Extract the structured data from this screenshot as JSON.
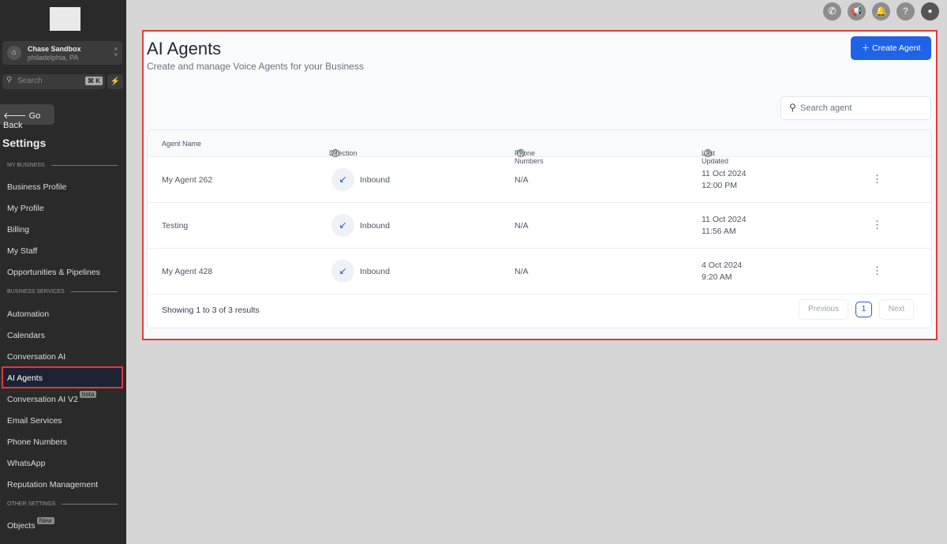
{
  "account": {
    "name": "Chase Sandbox",
    "location": "philadelphia, PA"
  },
  "search": {
    "placeholder": "Search",
    "shortcut": "⌘ K"
  },
  "go_back": "Go Back",
  "settings_title": "Settings",
  "sections": {
    "my_business": "MY BUSINESS",
    "business_services": "BUSINESS SERVICES",
    "other_settings": "OTHER SETTINGS"
  },
  "nav": [
    "Business Profile",
    "My Profile",
    "Billing",
    "My Staff",
    "Opportunities & Pipelines",
    "Automation",
    "Calendars",
    "Conversation AI",
    "AI Agents",
    "Conversation AI V2",
    "Email Services",
    "Phone Numbers",
    "WhatsApp",
    "Reputation Management",
    "Objects"
  ],
  "badges": {
    "beta": "beta",
    "new": "New"
  },
  "page": {
    "title": "AI Agents",
    "subtitle": "Create and manage Voice Agents for your Business",
    "create_label": "Create Agent",
    "search_placeholder": "Search agent"
  },
  "table": {
    "headers": [
      "Agent Name",
      "Direction",
      "Phone Numbers",
      "Last Updated"
    ],
    "rows": [
      {
        "name": "My Agent 262",
        "direction": "Inbound",
        "phone": "N/A",
        "date": "11 Oct 2024",
        "time": "12:00 PM"
      },
      {
        "name": "Testing",
        "direction": "Inbound",
        "phone": "N/A",
        "date": "11 Oct 2024",
        "time": "11:56 AM"
      },
      {
        "name": "My Agent 428",
        "direction": "Inbound",
        "phone": "N/A",
        "date": "4 Oct 2024",
        "time": "9:20 AM"
      }
    ]
  },
  "pagination": {
    "summary": "Showing 1 to 3 of 3 results",
    "previous": "Previous",
    "current": "1",
    "next": "Next"
  }
}
